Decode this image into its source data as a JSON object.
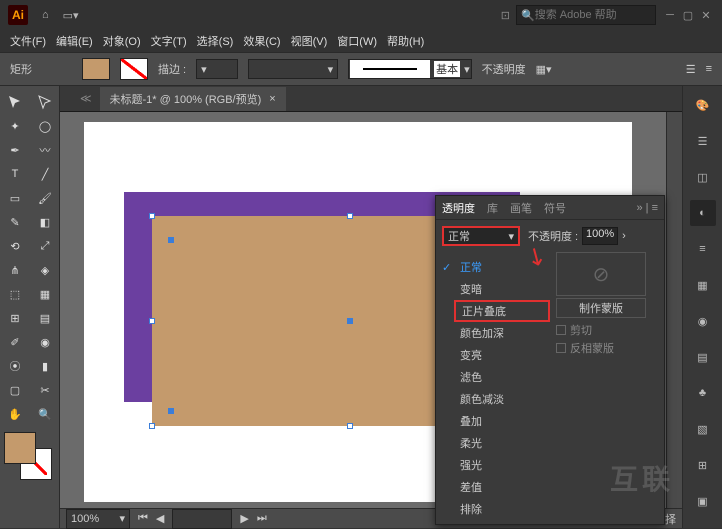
{
  "titlebar": {
    "search_placeholder": "搜索 Adobe 帮助"
  },
  "menu": [
    "文件(F)",
    "编辑(E)",
    "对象(O)",
    "文字(T)",
    "选择(S)",
    "效果(C)",
    "视图(V)",
    "窗口(W)",
    "帮助(H)"
  ],
  "optbar": {
    "shape_label": "矩形",
    "stroke_label": "描边 :",
    "stroke_width": "",
    "style_label": "基本",
    "opacity_label": "不透明度"
  },
  "document": {
    "tab_title": "未标题-1* @ 100% (RGB/预览)",
    "zoom": "100%",
    "nav_label": "选择"
  },
  "panel": {
    "tabs": [
      "透明度",
      "库",
      "画笔",
      "符号"
    ],
    "blend_selected": "正常",
    "opacity_label": "不透明度 :",
    "opacity_value": "100%",
    "dropdown": [
      "正常",
      "变暗",
      "正片叠底",
      "颜色加深",
      "变亮",
      "滤色",
      "颜色减淡",
      "叠加",
      "柔光",
      "强光",
      "差值",
      "排除"
    ],
    "mask_btn_label": "制作蒙版",
    "clip_label": "剪切",
    "invert_label": "反相蒙版"
  },
  "watermark": "互联"
}
